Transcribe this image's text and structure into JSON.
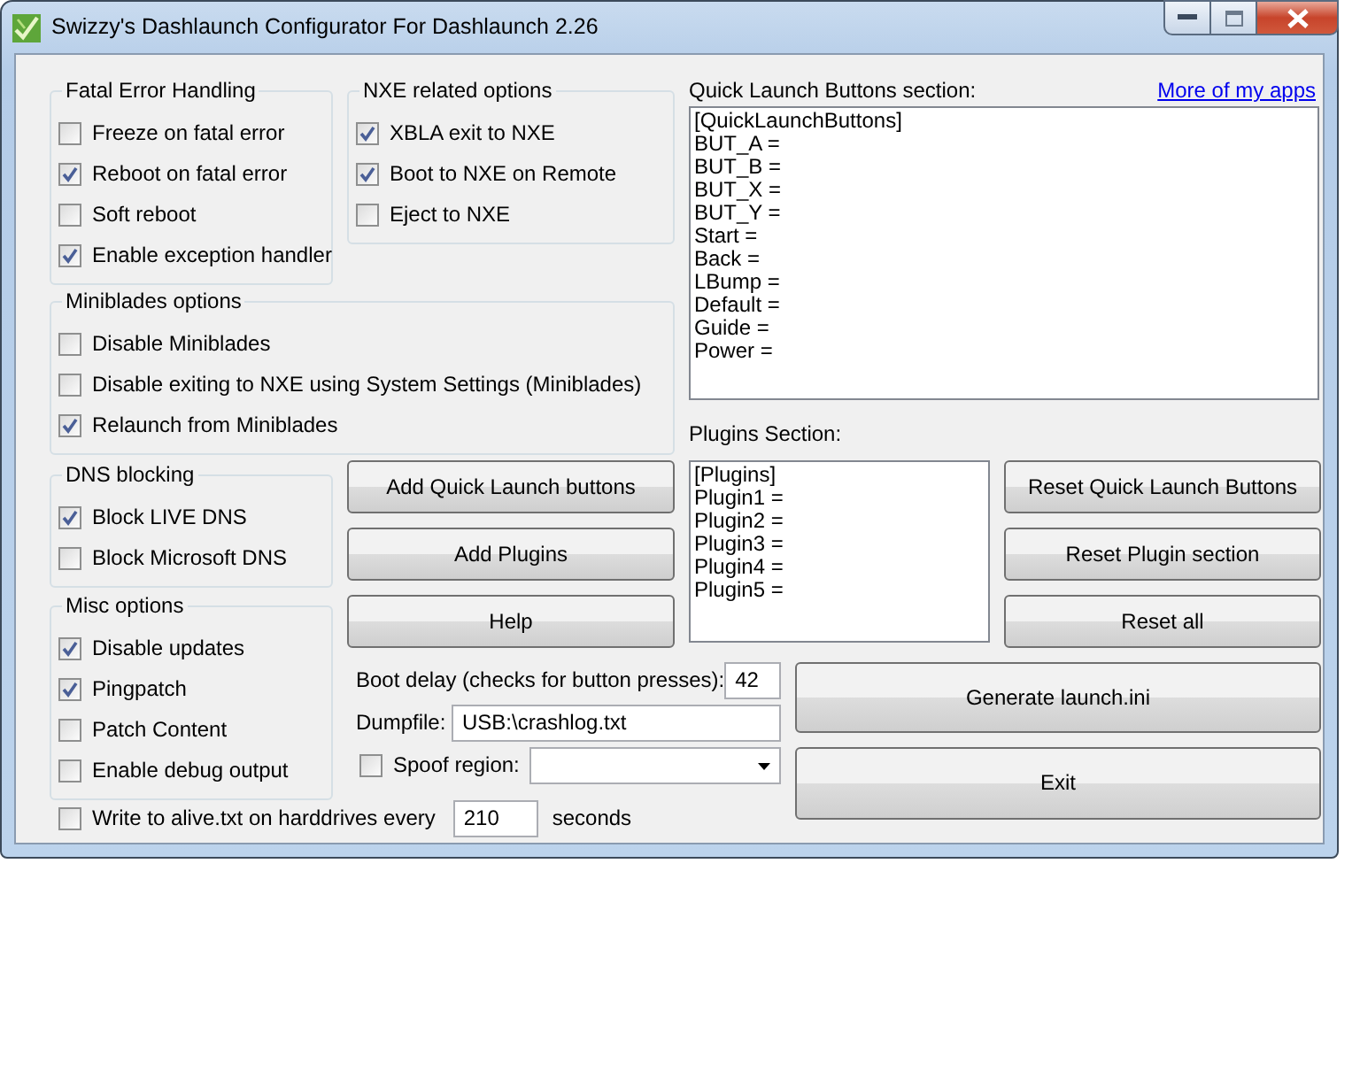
{
  "window": {
    "title": "Swizzy's Dashlaunch Configurator For Dashlaunch 2.26"
  },
  "groups": [
    {
      "title": "Fatal Error Handling",
      "options": [
        {
          "label": "Freeze on fatal error",
          "checked": false
        },
        {
          "label": "Reboot on fatal error",
          "checked": true
        },
        {
          "label": "Soft reboot",
          "checked": false
        },
        {
          "label": "Enable exception handler",
          "checked": true
        }
      ]
    },
    {
      "title": "NXE related options",
      "options": [
        {
          "label": "XBLA exit to NXE",
          "checked": true
        },
        {
          "label": "Boot to NXE on Remote",
          "checked": true
        },
        {
          "label": "Eject to NXE",
          "checked": false
        }
      ]
    },
    {
      "title": "Miniblades options",
      "options": [
        {
          "label": "Disable Miniblades",
          "checked": false
        },
        {
          "label": "Disable exiting to NXE using System Settings (Miniblades)",
          "checked": false
        },
        {
          "label": "Relaunch from Miniblades",
          "checked": true
        }
      ]
    },
    {
      "title": "DNS blocking",
      "options": [
        {
          "label": "Block LIVE DNS",
          "checked": true
        },
        {
          "label": "Block Microsoft DNS",
          "checked": false
        }
      ]
    },
    {
      "title": "Misc options",
      "options": [
        {
          "label": "Disable updates",
          "checked": true
        },
        {
          "label": "Pingpatch",
          "checked": true
        },
        {
          "label": "Patch Content",
          "checked": false
        },
        {
          "label": "Enable debug output",
          "checked": false
        }
      ]
    }
  ],
  "quick_launch": {
    "label": "Quick Launch Buttons section:",
    "link": "More of my apps",
    "lines": [
      "[QuickLaunchButtons]",
      "BUT_A =",
      "BUT_B =",
      "BUT_X =",
      "BUT_Y =",
      "Start =",
      "Back =",
      "LBump =",
      "Default =",
      "Guide =",
      "Power ="
    ]
  },
  "plugins": {
    "label": "Plugins Section:",
    "lines": [
      "[Plugins]",
      "Plugin1 =",
      "Plugin2 =",
      "Plugin3 =",
      "Plugin4 =",
      "Plugin5 ="
    ]
  },
  "add_buttons": [
    "Add Quick Launch buttons",
    "Add Plugins",
    "Help"
  ],
  "reset_buttons": [
    "Reset Quick Launch Buttons",
    "Reset Plugin section",
    "Reset all"
  ],
  "boot_delay": {
    "label": "Boot delay (checks for button presses):",
    "value": "42"
  },
  "dumpfile": {
    "label": "Dumpfile:",
    "value": "USB:\\crashlog.txt"
  },
  "spoof_region": {
    "label": "Spoof region:",
    "checked": false
  },
  "generate_button": "Generate launch.ini",
  "exit_button": "Exit",
  "alive": {
    "label": "Write to alive.txt on harddrives every",
    "checked": false,
    "value": "210",
    "unit": "seconds"
  }
}
